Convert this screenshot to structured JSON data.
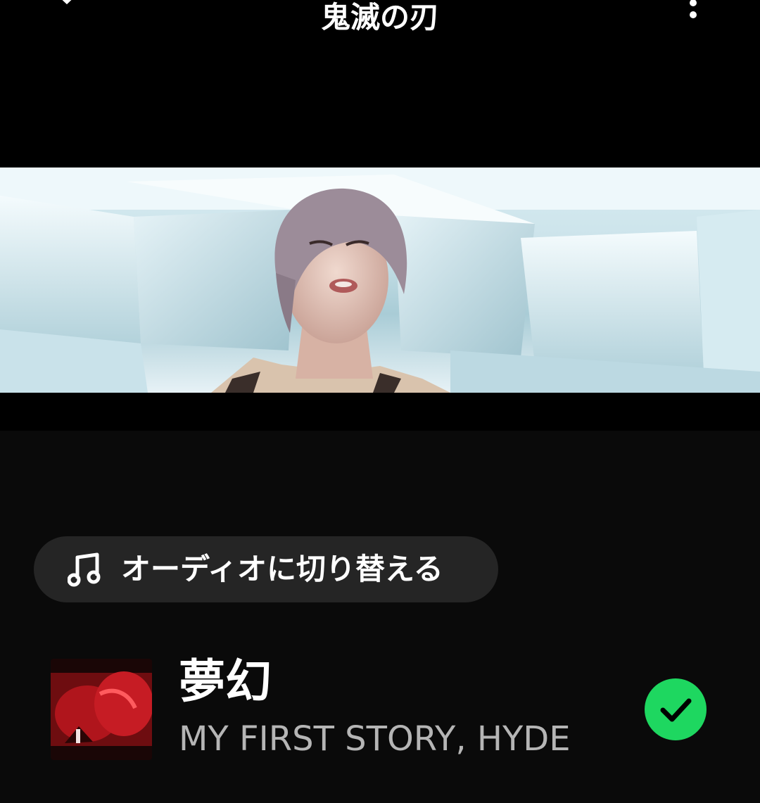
{
  "header": {
    "title": "鬼滅の刃",
    "collapse_icon": "chevron-down-icon",
    "more_icon": "more-vertical-icon"
  },
  "switch_button": {
    "label": "オーディオに切り替える",
    "icon": "music-note-icon"
  },
  "track": {
    "title": "夢幻",
    "artist": "MY FIRST STORY, HYDE",
    "status_icon": "check-circle-icon"
  },
  "colors": {
    "background": "#0a0a0a",
    "pill": "#252525",
    "accent_green": "#1ed760",
    "secondary_text": "#b5b5b5"
  }
}
